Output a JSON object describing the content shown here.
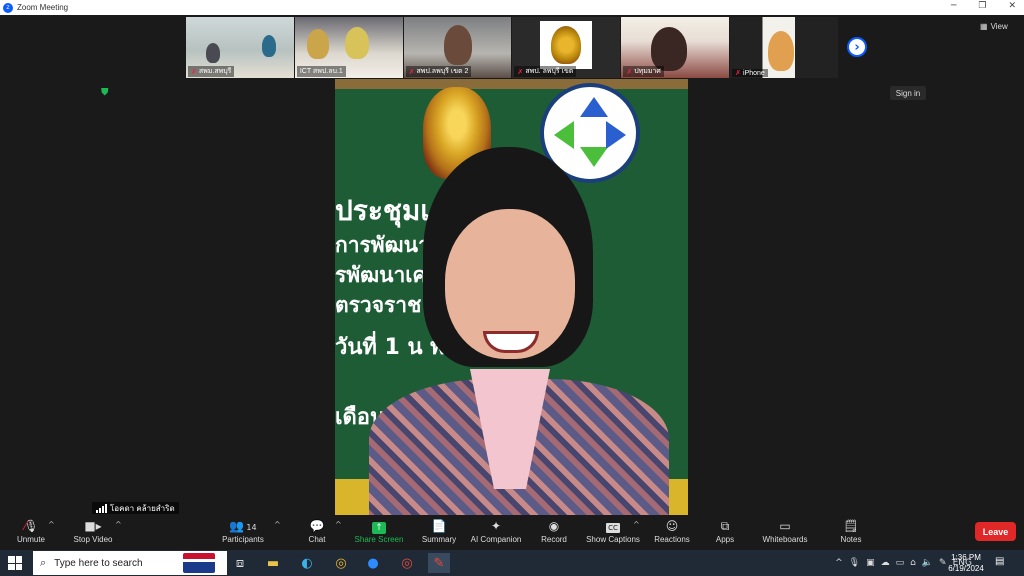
{
  "window": {
    "title": "Zoom Meeting",
    "app_icon": "zoom-icon"
  },
  "gallery": {
    "participants": [
      {
        "name": "สพม.สพบุรี",
        "muted": true
      },
      {
        "name": "ICT สพป.ลบ.1",
        "muted": false
      },
      {
        "name": "สพป.ลพบุรี เขต 2",
        "muted": true
      },
      {
        "name": "สพป. ลพบุรี เขต",
        "muted": true
      },
      {
        "name": "ปทุมมาศ",
        "muted": true
      },
      {
        "name": "iPhone",
        "muted": true
      }
    ],
    "next_icon": "chevron-right-icon"
  },
  "view_label": "View",
  "signin_label": "Sign in",
  "main_video": {
    "background_text": [
      "ประชุมเ     นเรียนรู",
      "การพัฒนา         นิเทศการ",
      "รพัฒนาเค            ศการศึกษ",
      "ตรวจราช               บประม",
      "วันที่ 1               น พ.",
      "เดือน                     วล"
    ]
  },
  "active_speaker": {
    "name": "โอคดา คล้ายสำริด"
  },
  "toolbar": {
    "items": [
      {
        "id": "unmute",
        "label": "Unmute",
        "icon": "microphone-muted-icon"
      },
      {
        "id": "stop-video",
        "label": "Stop Video",
        "icon": "video-camera-icon"
      },
      {
        "id": "participants",
        "label": "Participants",
        "icon": "participants-icon",
        "count": "14"
      },
      {
        "id": "chat",
        "label": "Chat",
        "icon": "chat-icon"
      },
      {
        "id": "share-screen",
        "label": "Share Screen",
        "icon": "share-screen-icon"
      },
      {
        "id": "summary",
        "label": "Summary",
        "icon": "summary-icon"
      },
      {
        "id": "ai-companion",
        "label": "AI Companion",
        "icon": "ai-sparkle-icon"
      },
      {
        "id": "record",
        "label": "Record",
        "icon": "record-icon"
      },
      {
        "id": "show-captions",
        "label": "Show Captions",
        "icon": "captions-icon"
      },
      {
        "id": "reactions",
        "label": "Reactions",
        "icon": "reactions-icon"
      },
      {
        "id": "apps",
        "label": "Apps",
        "icon": "apps-icon"
      },
      {
        "id": "whiteboards",
        "label": "Whiteboards",
        "icon": "whiteboard-icon"
      },
      {
        "id": "notes",
        "label": "Notes",
        "icon": "notes-icon"
      }
    ],
    "leave_label": "Leave"
  },
  "taskbar": {
    "search_placeholder": "Type here to search",
    "language": "ENG",
    "time": "1:36 PM",
    "date": "6/19/2024"
  },
  "colors": {
    "accent": "#0b5cff",
    "share_green": "#1db954",
    "leave_red": "#e02828",
    "meeting_bg": "#1a1a1a",
    "taskbar_bg": "#202a36"
  }
}
